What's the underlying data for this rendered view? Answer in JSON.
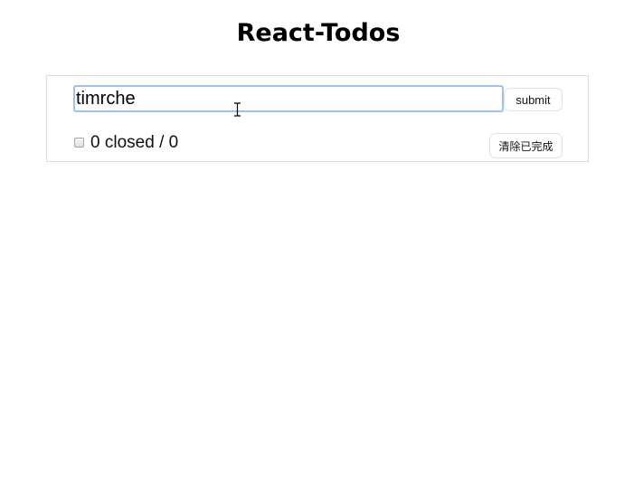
{
  "header": {
    "title": "React-Todos"
  },
  "form": {
    "input_value": "timrche",
    "submit_label": "submit"
  },
  "footer": {
    "completed_count": "0",
    "closed_word": "closed",
    "separator": "/",
    "total_count": "0",
    "clear_label": "清除已完成"
  },
  "icons": {
    "cursor": "text-cursor-icon"
  }
}
